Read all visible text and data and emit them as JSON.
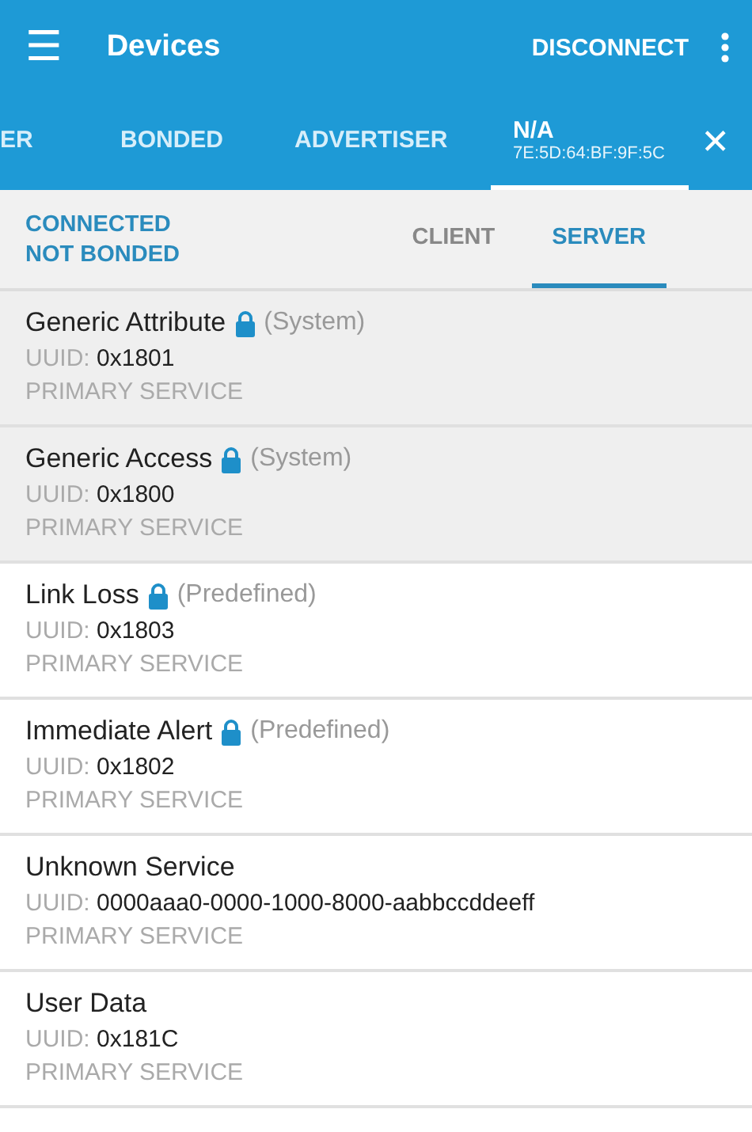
{
  "app_bar": {
    "menu_icon": "☰",
    "title": "Devices",
    "action": "DISCONNECT"
  },
  "tabs": [
    {
      "label": "ER",
      "selected": false
    },
    {
      "label": "BONDED",
      "selected": false
    },
    {
      "label": "ADVERTISER",
      "selected": false
    },
    {
      "label": "N/A",
      "address": "7E:5D:64:BF:9F:5C",
      "selected": true
    }
  ],
  "close_icon": "✕",
  "status": {
    "connection": "CONNECTED",
    "bond": "NOT BONDED"
  },
  "subtabs": [
    {
      "label": "CLIENT",
      "selected": false
    },
    {
      "label": "SERVER",
      "selected": true
    }
  ],
  "services": [
    {
      "name": "Generic Attribute",
      "locked": true,
      "tag": "(System)",
      "kind": "system",
      "uuid_label": "UUID:",
      "uuid": "0x1801",
      "type": "PRIMARY SERVICE"
    },
    {
      "name": "Generic Access",
      "locked": true,
      "tag": "(System)",
      "kind": "system",
      "uuid_label": "UUID:",
      "uuid": "0x1800",
      "type": "PRIMARY SERVICE"
    },
    {
      "name": "Link Loss",
      "locked": true,
      "tag": "(Predefined)",
      "kind": "predefined",
      "uuid_label": "UUID:",
      "uuid": "0x1803",
      "type": "PRIMARY SERVICE"
    },
    {
      "name": "Immediate Alert",
      "locked": true,
      "tag": "(Predefined)",
      "kind": "predefined",
      "uuid_label": "UUID:",
      "uuid": "0x1802",
      "type": "PRIMARY SERVICE"
    },
    {
      "name": "Unknown Service",
      "locked": false,
      "kind": "custom",
      "uuid_label": "UUID:",
      "uuid": "0000aaa0-0000-1000-8000-aabbccddeeff",
      "type": "PRIMARY SERVICE"
    },
    {
      "name": "User Data",
      "locked": false,
      "kind": "custom",
      "uuid_label": "UUID:",
      "uuid": "0x181C",
      "type": "PRIMARY SERVICE"
    }
  ]
}
